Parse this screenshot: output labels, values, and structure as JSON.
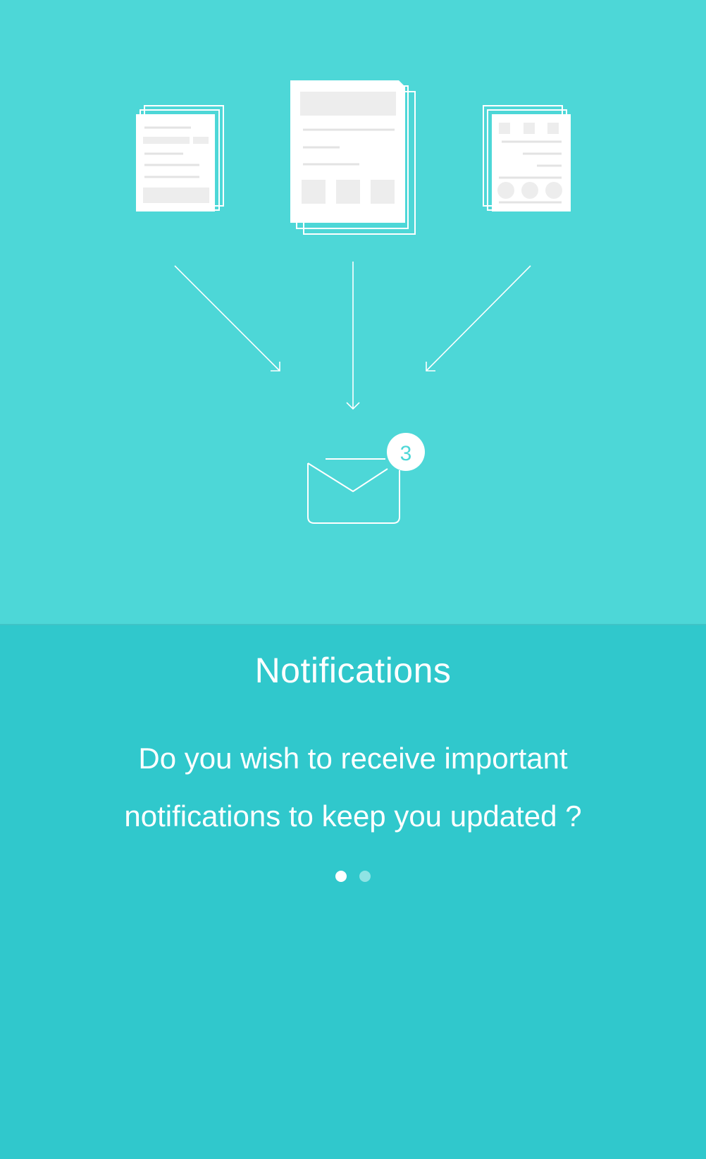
{
  "hero": {
    "badge_count": "3",
    "documents": [
      "document-form-icon",
      "document-layout-icon",
      "document-list-icon"
    ],
    "mail_icon": "envelope-icon"
  },
  "content": {
    "title": "Notifications",
    "description": "Do you wish to receive important notifications to keep you updated ?"
  },
  "pager": {
    "total": 2,
    "active_index": 0
  },
  "colors": {
    "hero_background": "#4DD7D7",
    "content_background": "#30C8CC",
    "foreground": "#FFFFFF",
    "inactive_dot": "#8FE3E4"
  }
}
